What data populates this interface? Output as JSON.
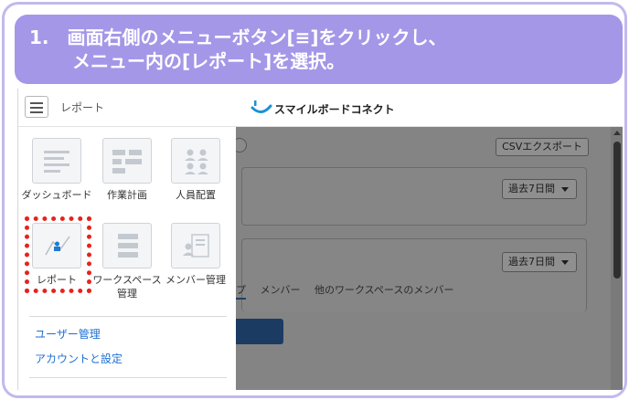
{
  "instruction": {
    "line1": "1.　画面右側のメニューボタン[≡]をクリックし、",
    "line2": "メニュー内の[レポート]を選択。"
  },
  "topbar": {
    "title": "レポート",
    "brand": "スマイルボードコネクト"
  },
  "drawer": {
    "tiles": [
      {
        "label": "ダッシュボード",
        "icon": "dashboard-icon"
      },
      {
        "label": "作業計画",
        "icon": "gantt-icon"
      },
      {
        "label": "人員配置",
        "icon": "people-icon"
      },
      {
        "label": "レポート",
        "icon": "report-chart-icon",
        "highlighted": true
      },
      {
        "label": "ワークスペース管理",
        "icon": "workspace-icon"
      },
      {
        "label": "メンバー管理",
        "icon": "member-card-icon"
      }
    ],
    "links": [
      "ユーザー管理",
      "アカウントと設定"
    ]
  },
  "background": {
    "csv_button": "CSVエクスポート",
    "period1": "過去7日間",
    "period2": "過去7日間",
    "tabs": [
      "プ",
      "メンバー",
      "他のワークスペースのメンバー"
    ]
  },
  "colors": {
    "banner": "#a497e8",
    "highlight": "#e8231b",
    "link": "#1f6fd1"
  }
}
